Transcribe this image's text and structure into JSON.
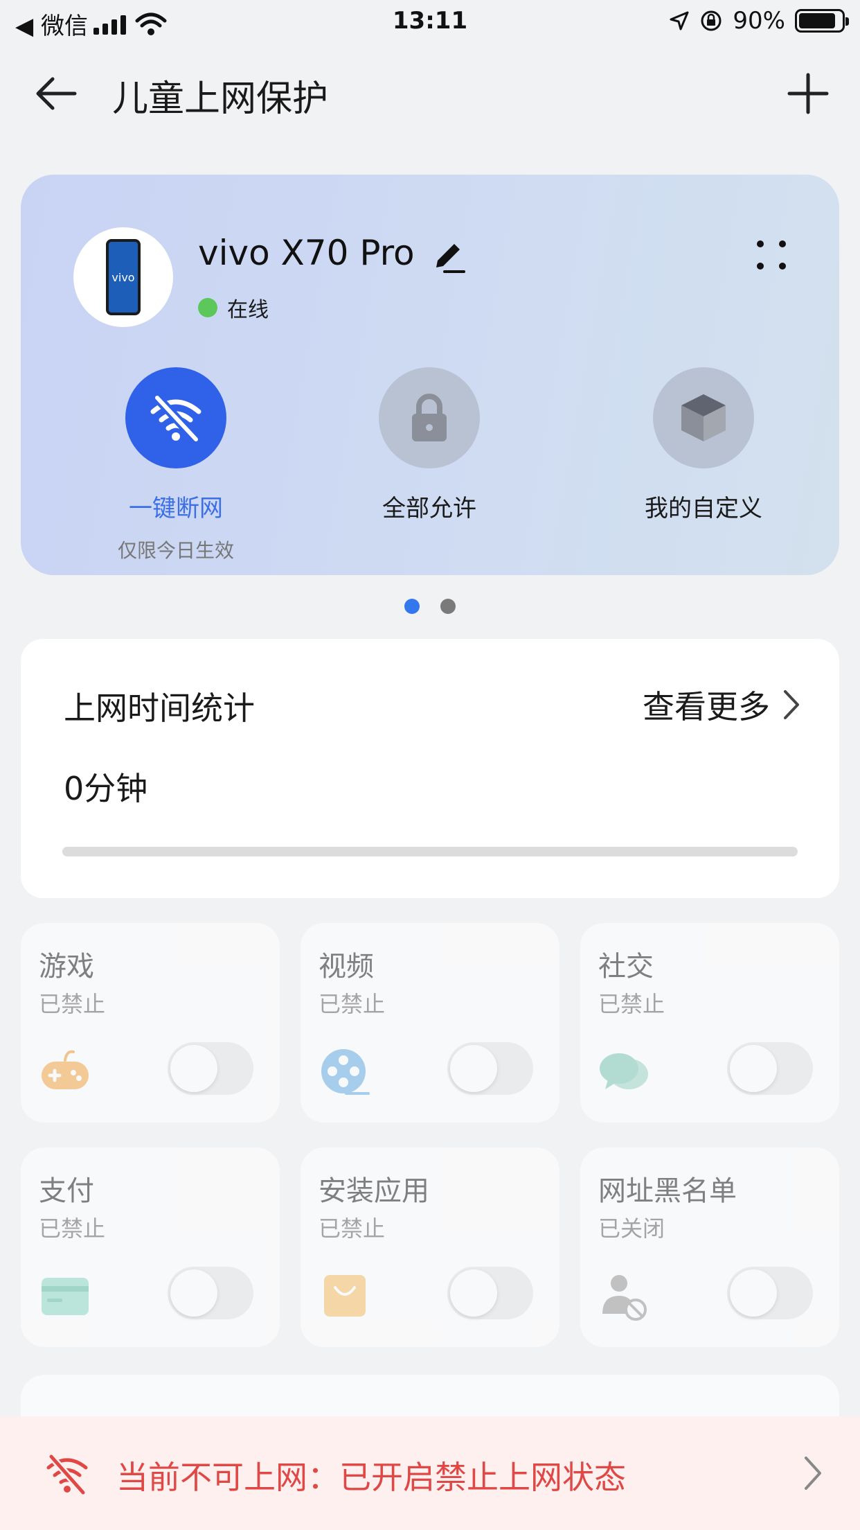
{
  "status_bar": {
    "back_app": "◀ 微信",
    "time": "13:11",
    "battery": "90%"
  },
  "nav": {
    "title": "儿童上网保护"
  },
  "device": {
    "name": "vivo X70 Pro",
    "status": "在线",
    "phone_brand": "vivo",
    "modes": [
      {
        "label": "一键断网",
        "sub": "仅限今日生效",
        "icon": "wifi-off-icon",
        "active": true
      },
      {
        "label": "全部允许",
        "icon": "lock-icon",
        "active": false
      },
      {
        "label": "我的自定义",
        "icon": "cube-icon",
        "active": false
      }
    ]
  },
  "pager": {
    "pages": 2,
    "current": 1
  },
  "stats": {
    "title": "上网时间统计",
    "more": "查看更多",
    "value": "0分钟",
    "progress": 0
  },
  "categories": [
    {
      "title": "游戏",
      "status": "已禁止",
      "icon": "gamepad-icon",
      "on": false
    },
    {
      "title": "视频",
      "status": "已禁止",
      "icon": "film-reel-icon",
      "on": false
    },
    {
      "title": "社交",
      "status": "已禁止",
      "icon": "chat-bubbles-icon",
      "on": false
    },
    {
      "title": "支付",
      "status": "已禁止",
      "icon": "card-icon",
      "on": false
    },
    {
      "title": "安装应用",
      "status": "已禁止",
      "icon": "shopping-bag-icon",
      "on": false
    },
    {
      "title": "网址黑名单",
      "status": "已关闭",
      "icon": "user-blocked-icon",
      "on": false
    }
  ],
  "alert": {
    "text": "当前不可上网：已开启禁止上网状态"
  },
  "colors": {
    "accent": "#2f62e8",
    "alert": "#e04845",
    "online": "#5cc85c"
  }
}
